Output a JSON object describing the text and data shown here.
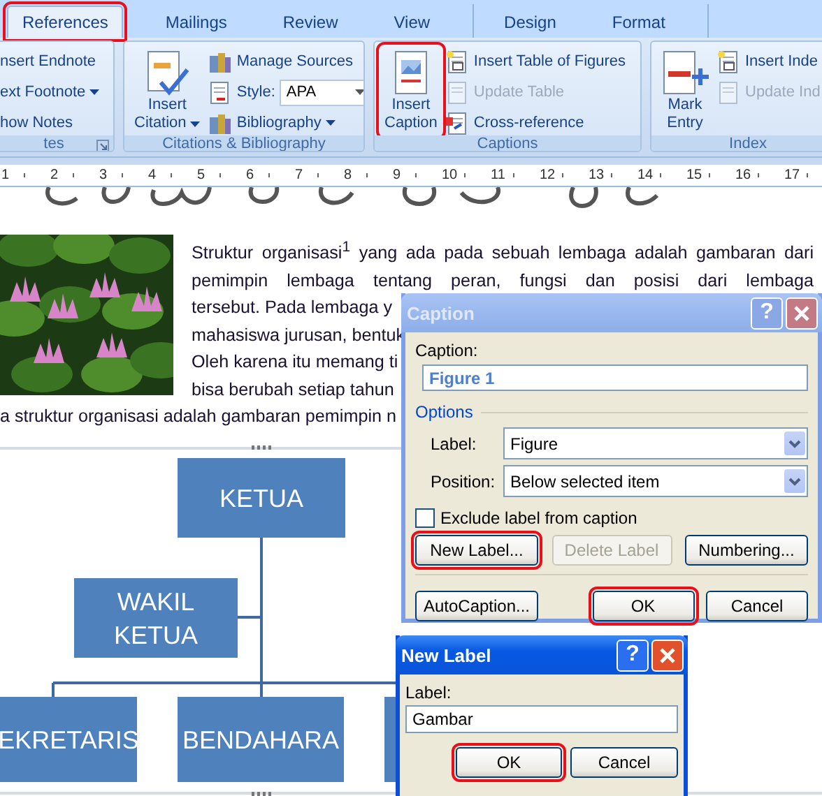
{
  "tabs": [
    {
      "label": "References",
      "kind": "main",
      "selected": true,
      "highlighted": true
    },
    {
      "label": "Mailings",
      "kind": "main",
      "selected": false,
      "highlighted": false
    },
    {
      "label": "Review",
      "kind": "main",
      "selected": false,
      "highlighted": false
    },
    {
      "label": "View",
      "kind": "main",
      "selected": false,
      "highlighted": false
    },
    {
      "label": "Design",
      "kind": "contextual",
      "selected": false,
      "highlighted": false
    },
    {
      "label": "Format",
      "kind": "contextual",
      "selected": false,
      "highlighted": false
    }
  ],
  "ribbon_groups": [
    {
      "label": "tes",
      "launcher": true,
      "items": [
        {
          "label": "nsert Endnote",
          "kind": "button",
          "disabled": false
        },
        {
          "label": "ext Footnote",
          "kind": "button",
          "disabled": false,
          "dropdown": true
        },
        {
          "label": "how Notes",
          "kind": "button",
          "disabled": false
        }
      ]
    },
    {
      "label": "Citations & Bibliography",
      "large_button": {
        "lines": [
          "Insert",
          "Citation"
        ],
        "dropdown": true,
        "highlighted": false
      },
      "items": [
        {
          "label": "Manage Sources",
          "kind": "button",
          "disabled": false
        },
        {
          "label": "Style:",
          "kind": "select",
          "value": "APA",
          "disabled": false,
          "dropdown": true
        },
        {
          "label": "Bibliography",
          "kind": "button",
          "disabled": false,
          "dropdown": true
        }
      ]
    },
    {
      "label": "Captions",
      "large_button": {
        "lines": [
          "Insert",
          "Caption"
        ],
        "highlighted": true
      },
      "items": [
        {
          "label": "Insert Table of Figures",
          "kind": "button",
          "disabled": false
        },
        {
          "label": "Update Table",
          "kind": "button",
          "disabled": true
        },
        {
          "label": "Cross-reference",
          "kind": "button",
          "disabled": false
        }
      ]
    },
    {
      "label": "Index",
      "large_button": {
        "lines": [
          "Mark",
          "Entry"
        ],
        "highlighted": false
      },
      "items": [
        {
          "label": "Insert Inde",
          "kind": "button",
          "disabled": false
        },
        {
          "label": "Update Ind",
          "kind": "button",
          "disabled": true
        }
      ]
    }
  ],
  "ruler": [
    "1",
    "2",
    "3",
    "4",
    "5",
    "6",
    "7",
    "8",
    "9",
    "10",
    "11",
    "12",
    "13",
    "14",
    "15",
    "16",
    "17"
  ],
  "document": {
    "paragraph_lines": [
      {
        "text": "Struktur organisasi$^{1}$ yang ada pada sebuah lembaga adalah gambaran dari",
        "justified": true
      },
      {
        "text": "pemimpin lembaga tentang peran, fungsi dan posisi dari lembaga",
        "justified": true
      },
      {
        "text": "tersebut. Pada lembaga y",
        "justified": false
      },
      {
        "text": "mahasiswa jurusan, bentuk",
        "justified": false
      },
      {
        "text": "Oleh karena itu memang ti",
        "justified": false
      },
      {
        "text": "bisa berubah setiap tahun",
        "justified": false
      }
    ],
    "last_line": "a struktur organisasi adalah gambaran pemimpin n",
    "org_chart": {
      "nodes": [
        {
          "label": "KETUA"
        },
        {
          "label": "WAKIL KETUA"
        },
        {
          "label": "EKRETARIS"
        },
        {
          "label": "BENDAHARA"
        }
      ]
    }
  },
  "caption_dialog": {
    "title": "Caption",
    "help": "?",
    "caption_label": "Caption:",
    "caption_value": "Figure 1",
    "options_label": "Options",
    "fields": [
      {
        "label": "Label:",
        "value": "Figure"
      },
      {
        "label": "Position:",
        "value": "Below selected item"
      }
    ],
    "exclude": {
      "label": "Exclude label from caption",
      "checked": false
    },
    "label_buttons": [
      {
        "label": "New Label...",
        "disabled": false,
        "highlighted": true
      },
      {
        "label": "Delete Label",
        "disabled": true,
        "highlighted": false
      },
      {
        "label": "Numbering...",
        "disabled": false,
        "highlighted": false
      }
    ],
    "bottom_buttons": [
      {
        "label": "AutoCaption...",
        "disabled": false,
        "highlighted": false
      },
      {
        "label": "OK",
        "disabled": false,
        "highlighted": true
      },
      {
        "label": "Cancel",
        "disabled": false,
        "highlighted": false
      }
    ]
  },
  "new_label_dialog": {
    "title": "New Label",
    "help": "?",
    "field_label": "Label:",
    "value": "Gambar",
    "buttons": [
      {
        "label": "OK",
        "highlighted": true
      },
      {
        "label": "Cancel",
        "highlighted": false
      }
    ]
  }
}
